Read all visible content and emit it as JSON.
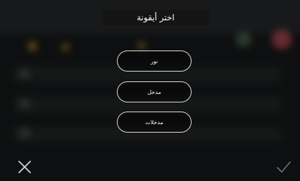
{
  "dialog": {
    "title": "اختر أيقونة"
  },
  "options": [
    {
      "label": "نور"
    },
    {
      "label": "مدخل"
    },
    {
      "label": "مدخلات"
    }
  ],
  "icons": {
    "close": "close-icon",
    "confirm": "check-icon"
  },
  "colors": {
    "header_bg": "#141414",
    "text": "#ffffff",
    "pill_border": "#dcdcdc",
    "confirm_icon": "#6f7173",
    "close_icon": "#e0e0e0"
  }
}
